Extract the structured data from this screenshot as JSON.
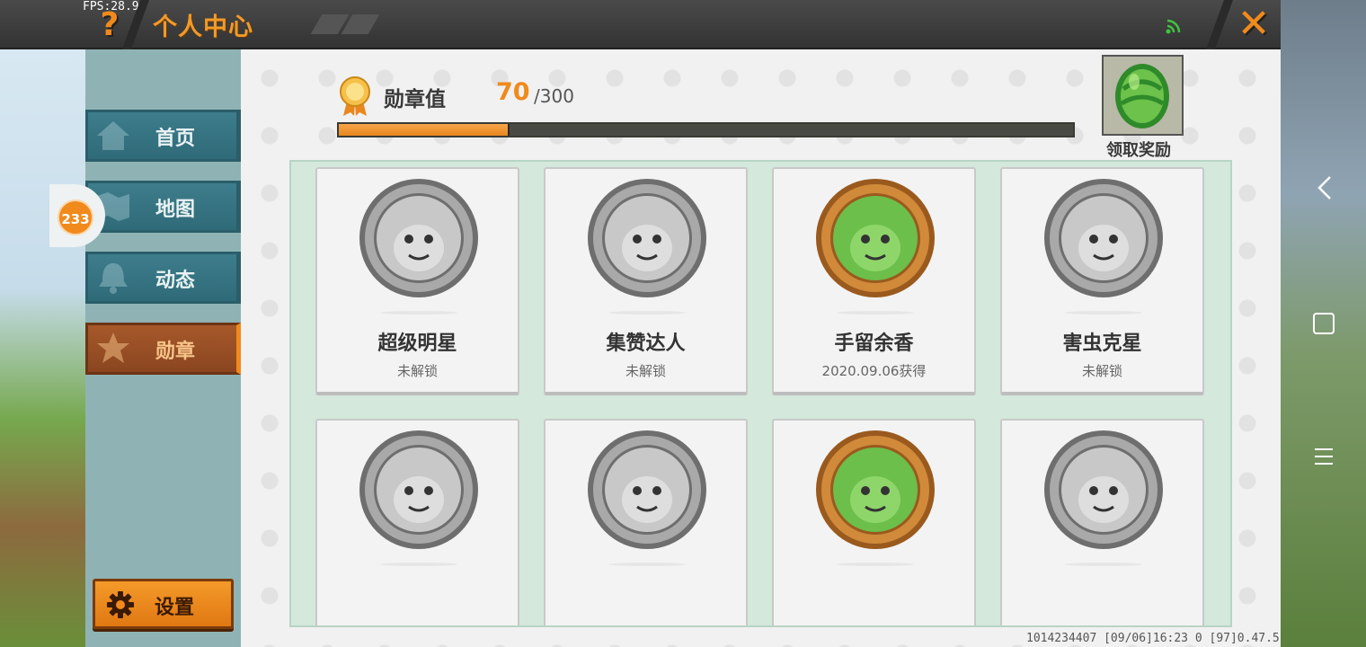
{
  "status": {
    "fps": "FPS:28.9"
  },
  "header": {
    "title": "个人中心",
    "help_icon": "question-mark",
    "close_icon": "close-x"
  },
  "sidebar": {
    "items": [
      {
        "label": "首页",
        "icon": "home-icon",
        "active": false
      },
      {
        "label": "地图",
        "icon": "map-icon",
        "active": false
      },
      {
        "label": "动态",
        "icon": "bell-icon",
        "active": false
      },
      {
        "label": "勋章",
        "icon": "medal-icon",
        "active": true
      }
    ],
    "settings_label": "设置"
  },
  "floating_badge": {
    "count": "233"
  },
  "medal_summary": {
    "title": "勋章值",
    "value": "70",
    "max": "/300",
    "progress_fraction": 0.233,
    "reward_label": "领取奖励"
  },
  "medals": [
    {
      "name": "超级明星",
      "status": "未解锁",
      "unlocked": false
    },
    {
      "name": "集赞达人",
      "status": "未解锁",
      "unlocked": false
    },
    {
      "name": "手留余香",
      "status": "2020.09.06获得",
      "unlocked": true
    },
    {
      "name": "害虫克星",
      "status": "未解锁",
      "unlocked": false
    },
    {
      "name": "",
      "status": "",
      "unlocked": false
    },
    {
      "name": "",
      "status": "",
      "unlocked": false
    },
    {
      "name": "",
      "status": "",
      "unlocked": true
    },
    {
      "name": "",
      "status": "",
      "unlocked": false
    }
  ],
  "footer": {
    "info": "1014234407   [09/06]16:23 0  [97]0.47.5"
  },
  "colors": {
    "accent": "#f08a1c",
    "teal": "#3e7d8c",
    "active_tab": "#a6592a"
  }
}
